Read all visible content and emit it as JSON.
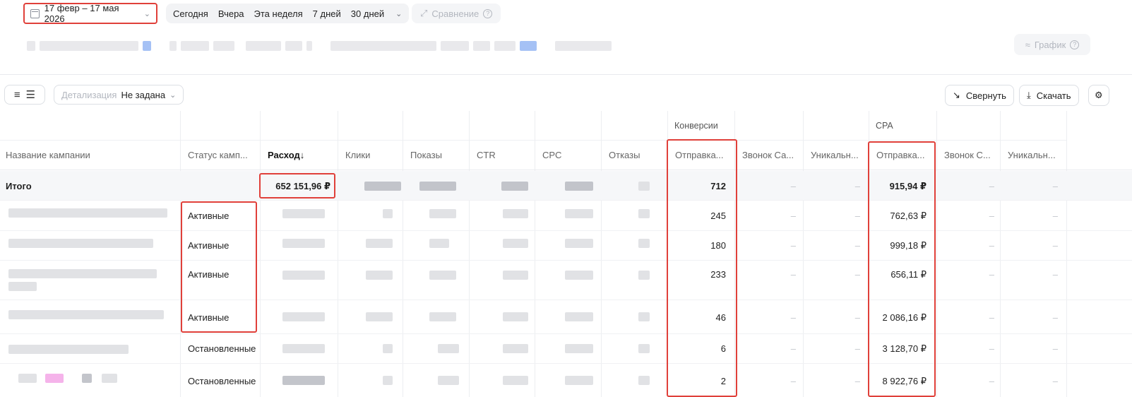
{
  "filters": {
    "date_range": "17 февр – 17 мая 2026",
    "periods": [
      "Сегодня",
      "Вчера",
      "Эта неделя",
      "7 дней",
      "30 дней"
    ],
    "compare_label": "Сравнение",
    "chart_label": "График"
  },
  "toolbar": {
    "detail_label": "Детализация",
    "detail_value": "Не задана",
    "collapse_label": "Свернуть",
    "download_label": "Скачать"
  },
  "table": {
    "group_headers": {
      "conversions": "Конверсии",
      "cpa": "CPA"
    },
    "columns": [
      "Название кампании",
      "Статус камп...",
      "Расход",
      "Клики",
      "Показы",
      "CTR",
      "CPC",
      "Отказы",
      "Отправка...",
      "Звонок Са...",
      "Уникальн...",
      "Отправка...",
      "Звонок С...",
      "Уникальн..."
    ],
    "sort_arrow": "↓",
    "dash": "–",
    "total": {
      "name": "Итого",
      "spend": "652 151,96 ₽",
      "conv_send": "712",
      "cpa_send": "915,94 ₽"
    },
    "rows": [
      {
        "status": "Активные",
        "conv_send": "245",
        "cpa_send": "762,63 ₽"
      },
      {
        "status": "Активные",
        "conv_send": "180",
        "cpa_send": "999,18 ₽"
      },
      {
        "status": "Активные",
        "conv_send": "233",
        "cpa_send": "656,11 ₽"
      },
      {
        "status": "Активные",
        "conv_send": "46",
        "cpa_send": "2 086,16 ₽"
      },
      {
        "status": "Остановленные",
        "conv_send": "6",
        "cpa_send": "3 128,70 ₽"
      },
      {
        "status": "Остановленные",
        "conv_send": "2",
        "cpa_send": "8 922,76 ₽"
      }
    ]
  },
  "colors": {
    "annotation": "#e0403a",
    "accent_blue": "#8fb2f2"
  }
}
